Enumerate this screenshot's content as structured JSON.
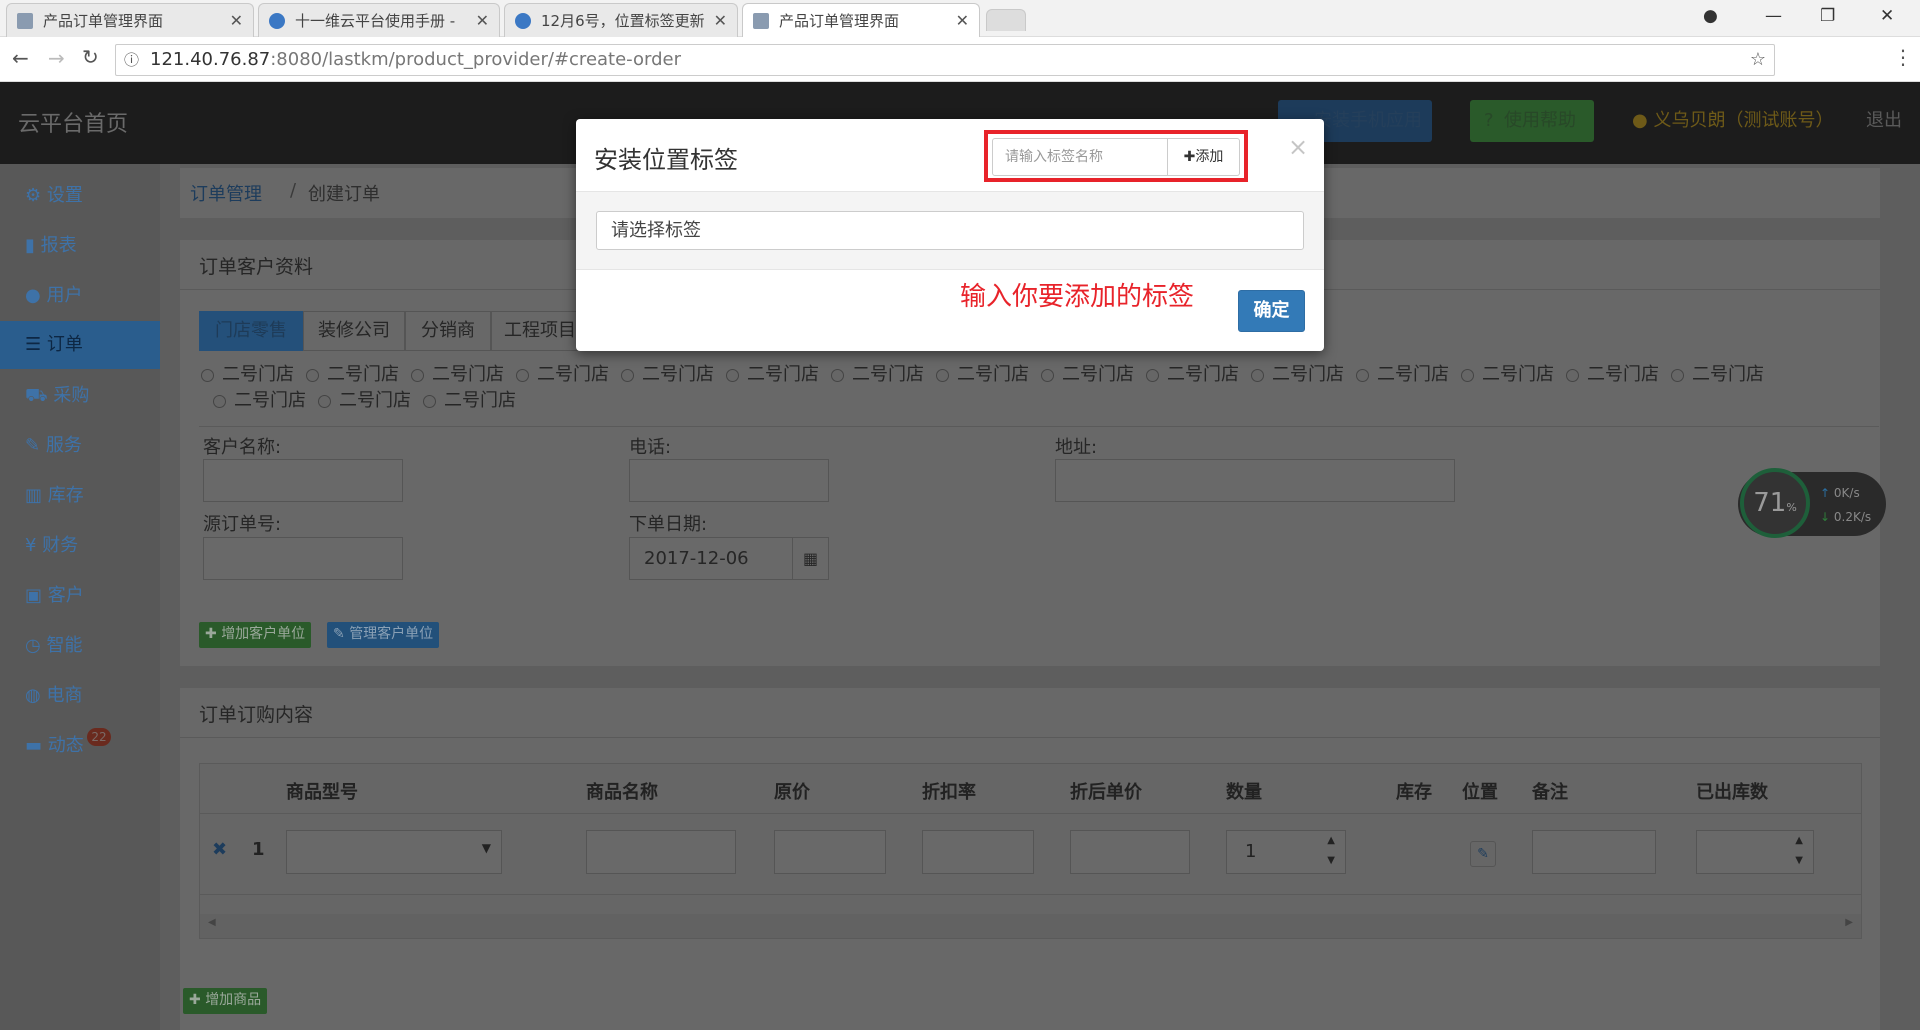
{
  "browser": {
    "tabs": [
      {
        "title": "产品订单管理界面",
        "active": false
      },
      {
        "title": "十一维云平台使用手册 -",
        "active": false
      },
      {
        "title": "12月6号，位置标签更新",
        "active": false
      },
      {
        "title": "产品订单管理界面",
        "active": true
      }
    ],
    "url_host": "121.40.76.87",
    "url_rest": ":8080/lastkm/product_provider/#create-order"
  },
  "topnav": {
    "brand": "云平台首页",
    "install_app": "安装手机应用",
    "help": "使用帮助",
    "user": "义乌贝朗（测试账号）",
    "logout": "退出"
  },
  "sidebar": {
    "items": [
      {
        "label": "设置",
        "icon": "gear-icon"
      },
      {
        "label": "报表",
        "icon": "bar-chart-icon"
      },
      {
        "label": "用户",
        "icon": "user-icon"
      },
      {
        "label": "订单",
        "icon": "list-icon",
        "active": true
      },
      {
        "label": "采购",
        "icon": "cart-icon"
      },
      {
        "label": "服务",
        "icon": "wrench-icon"
      },
      {
        "label": "库存",
        "icon": "barcode-icon"
      },
      {
        "label": "财务",
        "icon": "yen-icon"
      },
      {
        "label": "客户",
        "icon": "briefcase-icon"
      },
      {
        "label": "智能",
        "icon": "dashboard-icon"
      },
      {
        "label": "电商",
        "icon": "globe-icon"
      },
      {
        "label": "动态",
        "icon": "comment-icon",
        "badge": "22"
      }
    ]
  },
  "breadcrumb": {
    "root": "订单管理",
    "sep": "/",
    "current": "创建订单"
  },
  "customer_panel": {
    "title": "订单客户资料",
    "tabs": [
      "门店零售",
      "装修公司",
      "分销商",
      "工程项目"
    ],
    "stores": [
      "二号门店",
      "二号门店",
      "二号门店",
      "二号门店",
      "二号门店",
      "二号门店",
      "二号门店",
      "二号门店",
      "二号门店",
      "二号门店",
      "二号门店",
      "二号门店",
      "二号门店",
      "二号门店",
      "二号门店",
      "二号门店",
      "二号门店",
      "二号门店"
    ],
    "customer_name_label": "客户名称:",
    "phone_label": "电话:",
    "address_label": "地址:",
    "source_order_label": "源订单号:",
    "order_date_label": "下单日期:",
    "order_date_value": "2017-12-06",
    "add_unit": "增加客户单位",
    "manage_unit": "管理客户单位"
  },
  "order_panel": {
    "title": "订单订购内容",
    "columns": [
      "商品型号",
      "商品名称",
      "原价",
      "折扣率",
      "折后单价",
      "数量",
      "库存",
      "位置",
      "备注",
      "已出库数"
    ],
    "row": {
      "index": "1",
      "qty": "1"
    },
    "add_product": "增加商品"
  },
  "net_widget": {
    "cpu": "71",
    "unit": "%",
    "up": "0K/s",
    "down": "0.2K/s"
  },
  "modal": {
    "title": "安装位置标签",
    "tag_placeholder": "请输入标签名称",
    "add_button": "添加",
    "select_placeholder": "请选择标签",
    "annotation": "输入你要添加的标签",
    "confirm": "确定",
    "close": "×"
  },
  "colors": {
    "highlight_box": "#e8232a",
    "annotation": "#e8232a",
    "primary": "#337ab7",
    "success": "#5cb85c"
  }
}
